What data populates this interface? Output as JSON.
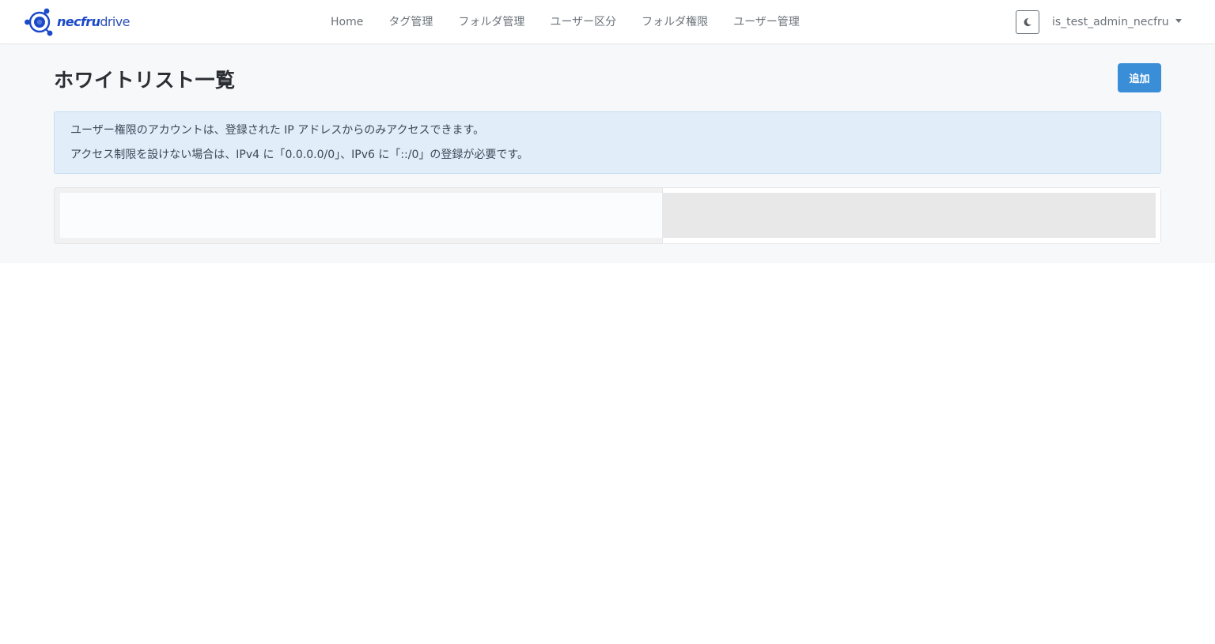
{
  "navbar": {
    "brand": {
      "strong": "necfru",
      "light": "drive"
    },
    "links": [
      "Home",
      "タグ管理",
      "フォルダ管理",
      "ユーザー区分",
      "フォルダ権限",
      "ユーザー管理"
    ],
    "theme_icon": "moon-icon",
    "username": "is_test_admin_necfru"
  },
  "page": {
    "title": "ホワイトリスト一覧",
    "add_label": "追加"
  },
  "alert": {
    "line1": "ユーザー権限のアカウントは、登録された IP アドレスからのみアクセスできます。",
    "line2": "アクセス制限を設けない場合は、IPv4 に「0.0.0.0/0」、IPv6 に「::/0」の登録が必要です。"
  },
  "colors": {
    "brand": "#1a49c9",
    "primary_button": "#3a8ed8",
    "alert_bg": "#e1edf9",
    "page_bg": "#f6f8fa"
  }
}
